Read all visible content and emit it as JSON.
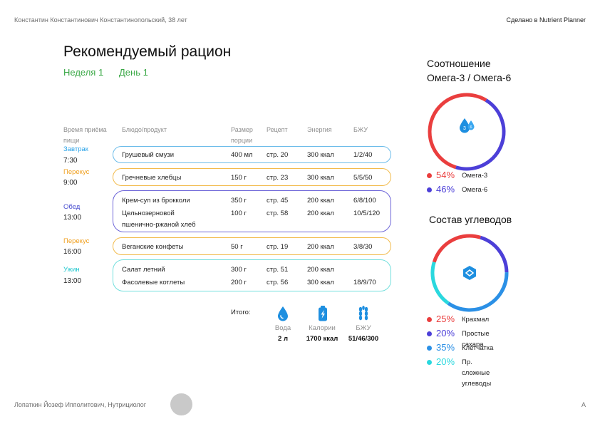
{
  "header": {
    "patient": "Константин Константинович Константинопольский, 38 лет",
    "made_in": "Сделано в Nutrient Planner"
  },
  "page": {
    "title": "Рекомендуемый рацион",
    "week": "Неделя 1",
    "day": "День 1"
  },
  "table": {
    "headers": {
      "time_l1": "Время приёма",
      "time_l2": "пищи",
      "dish": "Блюдо/продукт",
      "size_l1": "Размер",
      "size_l2": "порции",
      "recipe": "Рецепт",
      "energy": "Энергия",
      "bju": "БЖУ"
    },
    "meals": [
      {
        "name": "Завтрак",
        "time": "7:30",
        "color": "#2aa3e8",
        "border": "#6cbcea",
        "rows": [
          {
            "dish": "Грушевый смузи",
            "size": "400 мл",
            "recipe": "стр. 20",
            "energy": "300 ккал",
            "bju": "1/2/40"
          }
        ]
      },
      {
        "name": "Перекус",
        "time": "9:00",
        "color": "#f0a020",
        "border": "#f2bb4c",
        "rows": [
          {
            "dish": "Гречневые хлебцы",
            "size": "150 г",
            "recipe": "стр. 23",
            "energy": "300 ккал",
            "bju": "5/5/50"
          }
        ]
      },
      {
        "name": "Обед",
        "time": "13:00",
        "color": "#4a4fd0",
        "border": "#6e66d8",
        "rows": [
          {
            "dish": "Крем-суп из брокколи",
            "size": "350 г",
            "recipe": "стр. 45",
            "energy": "200 ккал",
            "bju": "6/8/100"
          },
          {
            "dish_l1": "Цельнозерновой",
            "dish_l2": "пшенично-ржаной хлеб",
            "size": "100 г",
            "recipe": "стр. 58",
            "energy": "200 ккал",
            "bju": "10/5/120"
          }
        ]
      },
      {
        "name": "Перекус",
        "time": "16:00",
        "color": "#f0a020",
        "border": "#f2bb4c",
        "rows": [
          {
            "dish": "Веганские конфеты",
            "size": "50 г",
            "recipe": "стр. 19",
            "energy": "200 ккал",
            "bju": "3/8/30"
          }
        ]
      },
      {
        "name": "Ужин",
        "time": "13:00",
        "color": "#22c9cf",
        "border": "#73dfdd",
        "rows": [
          {
            "dish": "Салат летний",
            "size": "300 г",
            "recipe": "стр. 51",
            "energy": "200 ккал",
            "bju": ""
          },
          {
            "dish": "Фасолевые котлеты",
            "size": "200 г",
            "recipe": "стр. 56",
            "energy": "300 ккал",
            "bju": "18/9/70"
          }
        ]
      }
    ]
  },
  "totals": {
    "label": "Итого:",
    "water_label": "Вода",
    "water_value": "2 л",
    "cal_label": "Калории",
    "cal_value": "1700 ккал",
    "bju_label": "БЖУ",
    "bju_value": "51/46/300",
    "icons": [
      "water-drop-icon",
      "battery-icon",
      "wheat-icon"
    ],
    "icon_color": "#1e8fe0"
  },
  "omega": {
    "title_l1": "Соотношение",
    "title_l2": "Омега-3 / Омега-6",
    "icon": "omega-drops-icon",
    "items": [
      {
        "pct": "54%",
        "label": "Омега-3",
        "value": 54,
        "color": "#ea3e3e"
      },
      {
        "pct": "46%",
        "label": "Омега-6",
        "value": 46,
        "color": "#4c3fd8"
      }
    ]
  },
  "carbs": {
    "title": "Состав углеводов",
    "icon": "carb-molecule-icon",
    "items": [
      {
        "pct": "25%",
        "label": "Крахмал",
        "value": 25,
        "color": "#ea3e3e"
      },
      {
        "pct": "20%",
        "label": "Простые сахара",
        "value": 20,
        "color": "#4c3fd8"
      },
      {
        "pct": "35%",
        "label": "Клетчатка",
        "value": 35,
        "color": "#2b90e6"
      },
      {
        "pct": "20%",
        "label_l1": "Пр. сложные",
        "label_l2": "углеводы",
        "value": 20,
        "color": "#2ad8de"
      }
    ]
  },
  "footer": {
    "nutritionist": "Лопаткин Йозеф Ипполитович, Нутрициолог",
    "page_letter": "A"
  }
}
